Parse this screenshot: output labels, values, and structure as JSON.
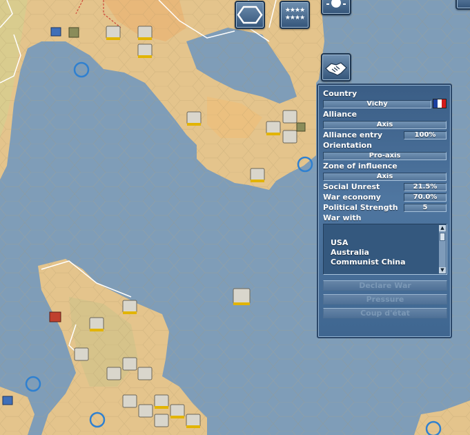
{
  "toolbar": {
    "hex_icon": "hexagon-icon",
    "stars_top": "★★★★",
    "stars_bottom": "★★★★",
    "weather_icon": "weather-icon",
    "diplomacy_icon": "handshake-icon"
  },
  "panel": {
    "country_label": "Country",
    "country_value": "Vichy",
    "flag_colors": [
      "#1a3fa0",
      "#ffffff",
      "#d11a1a"
    ],
    "alliance_label": "Alliance",
    "alliance_value": "Axis",
    "alliance_entry_label": "Alliance entry",
    "alliance_entry_value": "100%",
    "orientation_label": "Orientation",
    "orientation_value": "Pro-axis",
    "zone_label": "Zone of influence",
    "zone_value": "Axis",
    "social_unrest_label": "Social Unrest",
    "social_unrest_value": "21.5%",
    "war_economy_label": "War economy",
    "war_economy_value": "70.0%",
    "political_strength_label": "Political Strength",
    "political_strength_value": "5",
    "war_with_label": "War with",
    "war_with": [
      "USA",
      "Australia",
      "Communist China"
    ],
    "buttons": {
      "declare_war": "Declare War",
      "pressure": "Pressure",
      "coup": "Coup d'état"
    }
  },
  "colors": {
    "sea": "#7f9db8",
    "land": "#e6c98f",
    "land_green": "#c9c68a",
    "panel": "#4a6f98"
  }
}
